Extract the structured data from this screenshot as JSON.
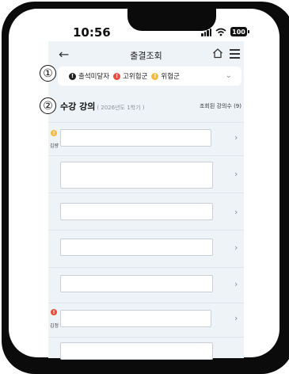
{
  "status_bar": {
    "time": "10:56",
    "battery": "100"
  },
  "header": {
    "back": "←",
    "title": "출결조회"
  },
  "legend": {
    "items": [
      {
        "icon": "!",
        "label": "출석미달자",
        "color": "#222222"
      },
      {
        "icon": "!",
        "label": "고위험군",
        "color": "#e74c3c"
      },
      {
        "icon": "!",
        "label": "위험군",
        "color": "#f5b942"
      }
    ],
    "chevron": "⌄"
  },
  "markers": {
    "first": "①",
    "second": "②"
  },
  "section": {
    "title": "수강 강의",
    "semester": "( 2026년도 1학기 )",
    "count_label": "조회된 강의수 (9)"
  },
  "rows": [
    {
      "name": "김량",
      "indicator": "!",
      "indicator_color": "#f5b942",
      "chevron": "›"
    },
    {
      "name": "",
      "chevron": "›"
    },
    {
      "name": "",
      "chevron": "›"
    },
    {
      "name": "",
      "chevron": "›"
    },
    {
      "name": "",
      "chevron": "›"
    },
    {
      "name": "김정",
      "indicator": "!",
      "indicator_color": "#e74c3c",
      "chevron": "›"
    },
    {
      "name": "",
      "chevron": "›"
    }
  ]
}
